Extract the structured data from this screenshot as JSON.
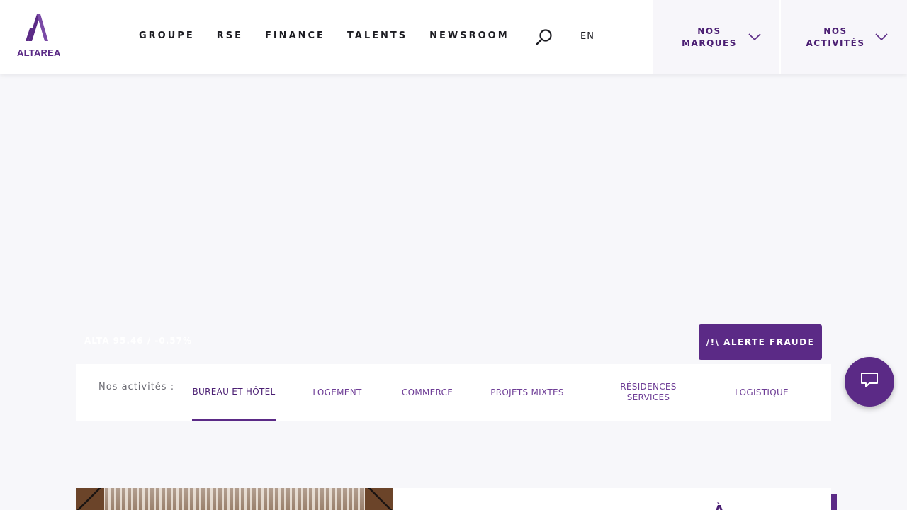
{
  "brand": {
    "logo_text": "ALTAREA",
    "color": "#5b2a86"
  },
  "nav": {
    "items": [
      {
        "label": "GROUPE"
      },
      {
        "label": "RSE"
      },
      {
        "label": "FINANCE"
      },
      {
        "label": "TALENTS"
      },
      {
        "label": "NEWSROOM"
      }
    ],
    "search_icon": "search-icon",
    "lang": "EN"
  },
  "dropdowns": {
    "marques": {
      "label": "NOS MARQUES",
      "icon": "chevron-down-icon"
    },
    "activites": {
      "label": "NOS ACTIVITÉS",
      "icon": "chevron-down-icon"
    }
  },
  "stock": {
    "text": "ALTA 95.46 / -0.57%"
  },
  "fraud_button": {
    "label": "/!\\ ALERTE FRAUDE"
  },
  "activities": {
    "label": "Nos activités :",
    "tabs": [
      {
        "label": "BUREAU ET HÔTEL",
        "active": true
      },
      {
        "label": "LOGEMENT",
        "active": false
      },
      {
        "label": "COMMERCE",
        "active": false
      },
      {
        "label": "PROJETS MIXTES",
        "active": false
      },
      {
        "label": "RÉSIDENCES SERVICES",
        "active": false
      },
      {
        "label": "LOGISTIQUE",
        "active": false
      }
    ]
  },
  "chat": {
    "icon": "chat-icon"
  },
  "card": {
    "heading_glyph": "À"
  }
}
